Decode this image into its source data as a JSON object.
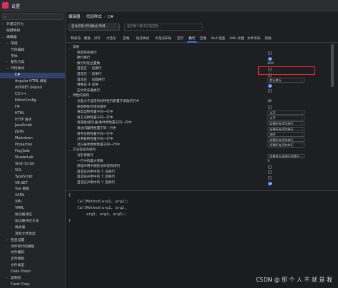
{
  "window": {
    "title": "设置"
  },
  "sidebar": {
    "items": [
      {
        "label": "外观与行为",
        "indent": 0,
        "chev": "›"
      },
      {
        "label": "按键映射",
        "indent": 0,
        "chev": ""
      },
      {
        "label": "编辑器",
        "indent": 0,
        "chev": "⌄"
      },
      {
        "label": "常规",
        "indent": 1,
        "chev": "›"
      },
      {
        "label": "代码编辑",
        "indent": 1,
        "chev": ""
      },
      {
        "label": "字体",
        "indent": 1,
        "chev": ""
      },
      {
        "label": "配色方案",
        "indent": 1,
        "chev": "›"
      },
      {
        "label": "代码样式",
        "indent": 1,
        "chev": "⌄"
      },
      {
        "label": "C#",
        "indent": 2,
        "chev": "",
        "selected": true
      },
      {
        "label": "Angular HTML 模板",
        "indent": 2,
        "chev": ""
      },
      {
        "label": "ASP.NET (Razor)",
        "indent": 2,
        "chev": ""
      },
      {
        "label": "C/C++",
        "indent": 2,
        "chev": ""
      },
      {
        "label": "EditorConfig",
        "indent": 2,
        "chev": ""
      },
      {
        "label": "F#",
        "indent": 2,
        "chev": ""
      },
      {
        "label": "HTML",
        "indent": 2,
        "chev": ""
      },
      {
        "label": "HTTP 请求",
        "indent": 2,
        "chev": ""
      },
      {
        "label": "JavaScript",
        "indent": 2,
        "chev": ""
      },
      {
        "label": "JSON",
        "indent": 2,
        "chev": ""
      },
      {
        "label": "Markdown",
        "indent": 2,
        "chev": ""
      },
      {
        "label": "Properties",
        "indent": 2,
        "chev": ""
      },
      {
        "label": "Pug/Jade",
        "indent": 2,
        "chev": ""
      },
      {
        "label": "ShaderLab",
        "indent": 2,
        "chev": ""
      },
      {
        "label": "Shell Script",
        "indent": 2,
        "chev": ""
      },
      {
        "label": "SQL",
        "indent": 2,
        "chev": "›"
      },
      {
        "label": "TypeScript",
        "indent": 2,
        "chev": ""
      },
      {
        "label": "VB.NET",
        "indent": 2,
        "chev": ""
      },
      {
        "label": "Vue 模板",
        "indent": 2,
        "chev": ""
      },
      {
        "label": "XAML",
        "indent": 2,
        "chev": ""
      },
      {
        "label": "XML",
        "indent": 2,
        "chev": ""
      },
      {
        "label": "YAML",
        "indent": 2,
        "chev": ""
      },
      {
        "label": "协议缓冲区",
        "indent": 2,
        "chev": ""
      },
      {
        "label": "协议缓冲区文本",
        "indent": 2,
        "chev": ""
      },
      {
        "label": "样式表",
        "indent": 2,
        "chev": "›"
      },
      {
        "label": "其他文件类型",
        "indent": 2,
        "chev": ""
      },
      {
        "label": "检查设置",
        "indent": 1,
        "chev": "›"
      },
      {
        "label": "文件和代码模板",
        "indent": 1,
        "chev": ""
      },
      {
        "label": "文件编码",
        "indent": 1,
        "chev": ""
      },
      {
        "label": "实时模板",
        "indent": 1,
        "chev": ""
      },
      {
        "label": "文件类型",
        "indent": 1,
        "chev": ""
      },
      {
        "label": "Code Vision",
        "indent": 1,
        "chev": ""
      },
      {
        "label": "复制权",
        "indent": 1,
        "chev": "›"
      },
      {
        "label": "Caret Copy",
        "indent": 1,
        "chev": ""
      }
    ]
  },
  "breadcrumb": [
    "编辑器",
    "代码样式",
    "C#"
  ],
  "scheme": {
    "value": "自动识别代码模式(项目...",
    "note": "基于数个解决方案范围…"
  },
  "tabs": [
    {
      "label": "制表符、缩进、对齐",
      "active": false
    },
    {
      "label": "大括号",
      "active": false
    },
    {
      "label": "空格",
      "active": false
    },
    {
      "label": "语法样式",
      "active": false
    },
    {
      "label": "大括号布局",
      "active": false
    },
    {
      "label": "空行",
      "active": false
    },
    {
      "label": "换行",
      "active": true
    },
    {
      "label": "空格",
      "active": false
    },
    {
      "label": "Null 检查",
      "active": false
    },
    {
      "label": "XML 文档",
      "active": false
    },
    {
      "label": "文件布局",
      "active": false
    },
    {
      "label": "其他",
      "active": false
    }
  ],
  "settings": [
    {
      "type": "group",
      "label": "常规"
    },
    {
      "type": "check",
      "label": "保留现有换行",
      "checked": false
    },
    {
      "type": "check",
      "label": "硬行换行",
      "checked": true
    },
    {
      "type": "value",
      "label": "换行时处位置数",
      "value": "200"
    },
    {
      "type": "check",
      "label": "首选在 '.' 前换行",
      "checked": false
    },
    {
      "type": "check",
      "label": "首选在 '.' 前换行",
      "checked": false
    },
    {
      "type": "dropdown",
      "label": "首选在 '.' 前面换行",
      "value": "默认换行"
    },
    {
      "type": "check",
      "label": "特殊在 IF 前导",
      "checked": true
    },
    {
      "type": "check",
      "label": "在文件末尾换行",
      "checked": false
    },
    {
      "type": "group",
      "label": "特性的排列"
    },
    {
      "type": "value",
      "label": "长度大于设定时对特性列表置于单独的行中",
      "value": "38"
    },
    {
      "type": "check",
      "label": "保留特性的现有排列",
      "checked": false
    },
    {
      "type": "dropdown",
      "label": "将类型特性置于同一行中",
      "value": "从不"
    },
    {
      "type": "dropdown",
      "label": "将方法特性置于同一行中",
      "value": "从不"
    },
    {
      "type": "dropdown",
      "label": "将属性/索引器/事件特性置于同一行中",
      "value": "如果所有项为单行"
    },
    {
      "type": "dropdown",
      "label": "将访问器特性置于同一行中",
      "value": "如果所有项为单行"
    },
    {
      "type": "dropdown",
      "label": "将字段特性置于同一行中",
      "value": "始终"
    },
    {
      "type": "dropdown",
      "label": "对参数特性置于同一行中",
      "value": "如果所有项为单行"
    },
    {
      "type": "dropdown",
      "label": "对记录参数特性置于同一行中",
      "value": "如果所有项为单行"
    },
    {
      "type": "group",
      "label": "方法签名的排列"
    },
    {
      "type": "dropdown",
      "label": "对形参换行",
      "value": "如果很长或多行则换行"
    },
    {
      "type": "value",
      "label": "一行中的最大参数",
      "value": "3"
    },
    {
      "type": "check",
      "label": "保留声明中圆括号的现有排列",
      "checked": false
    },
    {
      "type": "check",
      "label": "首选在声明中的 '(' 前换行",
      "checked": false
    },
    {
      "type": "check",
      "label": "首选在声明中的 '(' 后换行",
      "checked": false
    },
    {
      "type": "check",
      "label": "首选在声明中的 ')' 后换行",
      "checked": true
    }
  ],
  "preview": {
    "lines": [
      "{",
      "    CallMethod(arg1, arg2);",
      "    CallMethod(arg1, arg2,",
      "        arg3, arg4, arg5);",
      "}"
    ]
  },
  "watermark": "CSDN @ 那 个 人 不 就 是 我",
  "colors": {
    "accent": "#3574f0",
    "highlight": "#e0292b",
    "selection": "#2e436e"
  }
}
